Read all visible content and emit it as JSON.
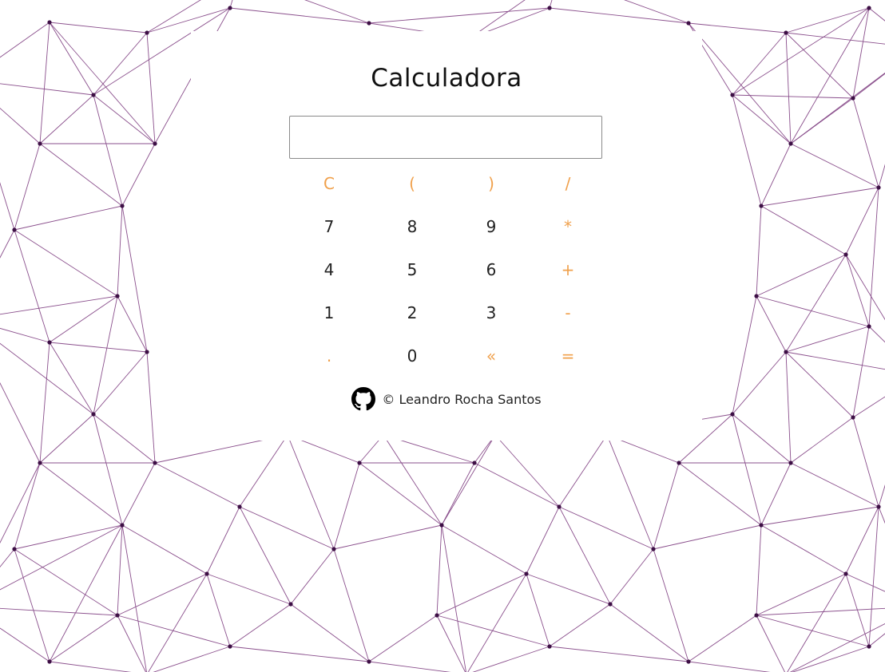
{
  "app": {
    "title": "Calculadora",
    "display_value": "",
    "accent_color": "#f0a04b",
    "pattern_color": "#8a4f8c"
  },
  "keypad": {
    "rows": [
      [
        {
          "label": "C",
          "kind": "op"
        },
        {
          "label": "(",
          "kind": "op"
        },
        {
          "label": ")",
          "kind": "op"
        },
        {
          "label": "/",
          "kind": "op"
        }
      ],
      [
        {
          "label": "7",
          "kind": "num"
        },
        {
          "label": "8",
          "kind": "num"
        },
        {
          "label": "9",
          "kind": "num"
        },
        {
          "label": "*",
          "kind": "op"
        }
      ],
      [
        {
          "label": "4",
          "kind": "num"
        },
        {
          "label": "5",
          "kind": "num"
        },
        {
          "label": "6",
          "kind": "num"
        },
        {
          "label": "+",
          "kind": "op"
        }
      ],
      [
        {
          "label": "1",
          "kind": "num"
        },
        {
          "label": "2",
          "kind": "num"
        },
        {
          "label": "3",
          "kind": "num"
        },
        {
          "label": "-",
          "kind": "op"
        }
      ],
      [
        {
          "label": ".",
          "kind": "op"
        },
        {
          "label": "0",
          "kind": "num"
        },
        {
          "label": "«",
          "kind": "op"
        },
        {
          "label": "=",
          "kind": "op"
        }
      ]
    ]
  },
  "footer": {
    "icon": "github-icon",
    "credit": "© Leandro Rocha Santos"
  }
}
